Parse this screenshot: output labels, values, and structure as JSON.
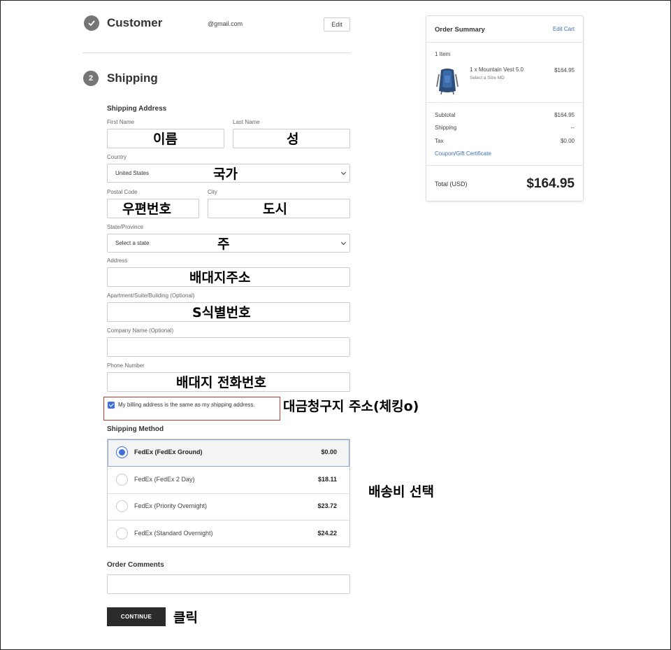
{
  "customer": {
    "title": "Customer",
    "email": "@gmail.com",
    "edit_label": "Edit"
  },
  "shipping": {
    "step_number": "2",
    "title": "Shipping",
    "address_heading": "Shipping Address",
    "fields": {
      "first_name": {
        "label": "First Name",
        "note": "이름"
      },
      "last_name": {
        "label": "Last Name",
        "note": "성"
      },
      "country": {
        "label": "Country",
        "value": "United States",
        "note": "국가"
      },
      "postal_code": {
        "label": "Postal Code",
        "note": "우편번호"
      },
      "city": {
        "label": "City",
        "note": "도시"
      },
      "state": {
        "label": "State/Province",
        "value": "Select a state",
        "note": "주"
      },
      "address": {
        "label": "Address",
        "note": "배대지주소"
      },
      "apartment": {
        "label": "Apartment/Suite/Building (Optional)",
        "note": "S식별번호"
      },
      "company": {
        "label": "Company Name (Optional)"
      },
      "phone": {
        "label": "Phone Number",
        "note": "배대지 전화번호"
      }
    },
    "billing_same": {
      "label": "My billing address is the same as my shipping address.",
      "checked": true,
      "note": "대금청구지 주소(체킹o)"
    },
    "method_heading": "Shipping Method",
    "method_note": "배송비 선택",
    "methods": [
      {
        "name": "FedEx (FedEx Ground)",
        "price": "$0.00",
        "selected": true
      },
      {
        "name": "FedEx (FedEx 2 Day)",
        "price": "$18.11",
        "selected": false
      },
      {
        "name": "FedEx (Priority Overnight)",
        "price": "$23.72",
        "selected": false
      },
      {
        "name": "FedEx (Standard Overnight)",
        "price": "$24.22",
        "selected": false
      }
    ],
    "comments_heading": "Order Comments",
    "continue_label": "CONTINUE",
    "continue_note": "클릭"
  },
  "summary": {
    "title": "Order Summary",
    "edit_cart": "Edit Cart",
    "item_count": "1 Item",
    "item": {
      "name": "1 x Mountain Vest 5.0",
      "variant": "Select a Size MD",
      "price": "$164.95",
      "image_icon": "backpack-vest-image"
    },
    "subtotal_label": "Subtotal",
    "subtotal_value": "$164.95",
    "shipping_label": "Shipping",
    "shipping_value": "--",
    "tax_label": "Tax",
    "tax_value": "$0.00",
    "coupon_label": "Coupon/Gift Certificate",
    "total_label": "Total (USD)",
    "total_value": "$164.95"
  },
  "colors": {
    "accent": "#3f6fd8",
    "link": "#3f6fb6",
    "highlight_box": "#c0392b",
    "button": "#2b2b2b"
  }
}
